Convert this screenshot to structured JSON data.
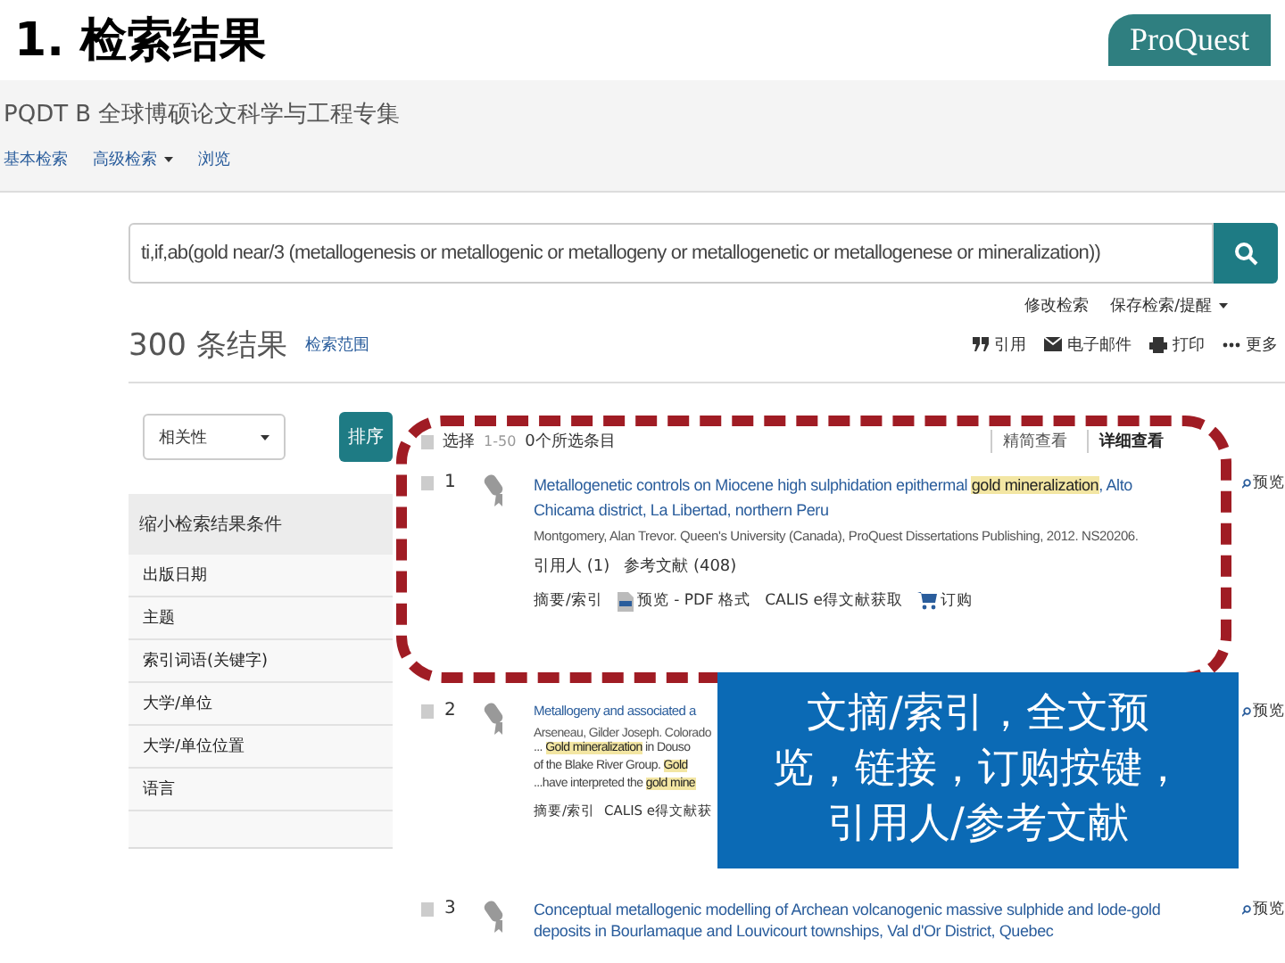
{
  "slide": {
    "title": "1. 检索结果",
    "logo": "ProQuest"
  },
  "header": {
    "database": "PQDT B 全球博硕论文科学与工程专集",
    "nav": [
      {
        "label": "基本检索",
        "dropdown": false
      },
      {
        "label": "高级检索",
        "dropdown": true
      },
      {
        "label": "浏览",
        "dropdown": false
      }
    ]
  },
  "search": {
    "value": "ti,if,ab(gold near/3 (metallogenesis or metallogenic or metallogeny or metallogenetic or metallogenese or mineralization))",
    "links": [
      {
        "label": "修改检索",
        "dropdown": false
      },
      {
        "label": "保存检索/提醒",
        "dropdown": true
      }
    ]
  },
  "results_bar": {
    "count": "300 条结果",
    "scope": "检索范围",
    "actions": [
      {
        "kind": "quote",
        "label": "引用"
      },
      {
        "kind": "mail",
        "label": "电子邮件"
      },
      {
        "kind": "print",
        "label": "打印"
      },
      {
        "kind": "more",
        "label": "更多"
      }
    ]
  },
  "sort": {
    "value": "相关性",
    "button": "排序"
  },
  "filters": {
    "title": "缩小检索结果条件",
    "items": [
      "出版日期",
      "主题",
      "索引词语(关键字)",
      "大学/单位",
      "大学/单位位置",
      "语言"
    ]
  },
  "list_bar": {
    "checked": false,
    "select": "选择",
    "range": "1-50",
    "selected_count": "0个所选条目",
    "views": [
      {
        "label": "精简查看",
        "selected": false
      },
      {
        "label": "详细查看",
        "selected": true
      }
    ]
  },
  "results": [
    {
      "number": "1",
      "checked": false,
      "title_parts": [
        {
          "text": "Metallogenetic controls on Miocene high sulphidation epithermal ",
          "highlight": false
        },
        {
          "text": "gold mineralization",
          "highlight": true
        },
        {
          "text": ", Alto Chicama district, La Libertad, northern Peru",
          "highlight": false
        }
      ],
      "meta": "Montgomery, Alan Trevor. Queen's University (Canada), ProQuest Dissertations Publishing, 2012. NS20206.",
      "citations": [
        "引用人 (1)",
        "参考文献 (408)"
      ],
      "links": [
        {
          "kind": "text",
          "label": "摘要/索引"
        },
        {
          "kind": "pdf",
          "label": "预览 - PDF 格式"
        },
        {
          "kind": "text",
          "label": "CALIS e得文献获取"
        },
        {
          "kind": "cart",
          "label": "订购"
        }
      ],
      "preview": "预览"
    },
    {
      "number": "2",
      "checked": false,
      "title_parts": [
        {
          "text": "Metallogeny and associated a",
          "highlight": false
        }
      ],
      "meta": "Arseneau, Gilder Joseph. Colorado",
      "snippets": [
        [
          {
            "text": "... ",
            "highlight": false
          },
          {
            "text": "Gold mineralization",
            "highlight": true
          },
          {
            "text": " in Douso",
            "highlight": false
          }
        ],
        [
          {
            "text": "of the Blake River Group. ",
            "highlight": false
          },
          {
            "text": "Gold",
            "highlight": true
          }
        ],
        [
          {
            "text": "...have interpreted the ",
            "highlight": false
          },
          {
            "text": "gold mine",
            "highlight": true
          }
        ]
      ],
      "links": [
        {
          "kind": "text",
          "label": "摘要/索引"
        },
        {
          "kind": "text",
          "label": "CALIS e得文献获"
        }
      ],
      "preview": "预览"
    },
    {
      "number": "3",
      "checked": false,
      "title_parts": [
        {
          "text": "Conceptual metallogenic modelling of Archean volcanogenic massive sulphide and lode-gold deposits in Bourlamaque and Louvicourt townships, Val d'Or District, Quebec",
          "highlight": false
        }
      ],
      "preview": "预览"
    }
  ],
  "callout": "文摘/索引，全文预览，链接，订购按键，引用人/参考文献"
}
